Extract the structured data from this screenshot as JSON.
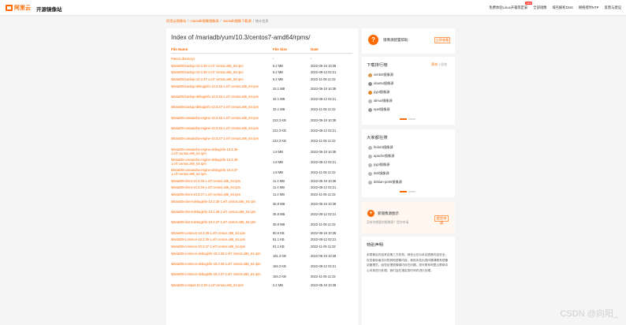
{
  "header": {
    "logo": "阿里云",
    "site_title": "开源镜像站",
    "nav": [
      "免费体验Linux开箱等定安",
      "全部镜像",
      "域名解析DNS",
      "网络授时NTP",
      "反馈与建议"
    ],
    "nav_badge": "NEW"
  },
  "breadcrumb": [
    "阿里云镜像站",
    "mariadb镜像镜像源",
    "mariadb镜像下载源",
    "统计信息"
  ],
  "listing": {
    "title": "Index of /mariadb/yum/10.3/centos7-amd64/rpms/",
    "headers": {
      "name": "File Name",
      "size": "File Size",
      "date": "Date"
    },
    "rows": [
      {
        "name": "Parent directory/",
        "size": "-",
        "date": "-"
      },
      {
        "name": "MariaDB-backup-10.3.35-1.el7.centos.x86_64.rpm",
        "size": "6.2 MB",
        "date": "2022-05-19 10:38"
      },
      {
        "name": "MariaDB-backup-10.3.36-1.el7.centos.x86_64.rpm",
        "size": "6.2 MB",
        "date": "2022-08-12 02:21"
      },
      {
        "name": "MariaDB-backup-10.3.37-1.el7.centos.x86_64.rpm",
        "size": "6.2 MB",
        "date": "2022-11-05 11:32"
      },
      {
        "name": "MariaDB-backup-debuginfo-10.3.35-1.el7.centos.x86_64.rpm",
        "size": "33.1 MB",
        "date": "2022-05-19 10:38"
      },
      {
        "name": "MariaDB-backup-debuginfo-10.3.36-1.el7.centos.x86_64.rpm",
        "size": "33.1 MB",
        "date": "2022-08-12 02:21"
      },
      {
        "name": "MariaDB-backup-debuginfo-10.3.37-1.el7.centos.x86_64.rpm",
        "size": "33.1 MB",
        "date": "2022-11-05 11:32"
      },
      {
        "name": "MariaDB-cassandra-engine-10.3.35-1.el7.centos.x86_64.rpm",
        "size": "222.3 KB",
        "date": "2022-05-19 10:38"
      },
      {
        "name": "MariaDB-cassandra-engine-10.3.36-1.el7.centos.x86_64.rpm",
        "size": "222.3 KB",
        "date": "2022-08-12 02:21"
      },
      {
        "name": "MariaDB-cassandra-engine-10.3.37-1.el7.centos.x86_64.rpm",
        "size": "222.3 KB",
        "date": "2022-11-05 11:32"
      },
      {
        "name": "MariaDB-cassandra-engine-debuginfo-10.3.35-1.el7.centos.x86_64.rpm",
        "size": "1.8 MB",
        "date": "2022-05-19 10:38"
      },
      {
        "name": "MariaDB-cassandra-engine-debuginfo-10.3.36-1.el7.centos.x86_64.rpm",
        "size": "1.8 MB",
        "date": "2022-08-12 02:21"
      },
      {
        "name": "MariaDB-cassandra-engine-debuginfo-10.3.37-1.el7.centos.x86_64.rpm",
        "size": "1.8 MB",
        "date": "2022-11-05 11:32"
      },
      {
        "name": "MariaDB-client-10.3.35-1.el7.centos.x86_64.rpm",
        "size": "11.4 MB",
        "date": "2022-05-19 10:38"
      },
      {
        "name": "MariaDB-client-10.3.36-1.el7.centos.x86_64.rpm",
        "size": "11.4 MB",
        "date": "2022-08-12 02:21"
      },
      {
        "name": "MariaDB-client-10.3.37-1.el7.centos.x86_64.rpm",
        "size": "11.4 MB",
        "date": "2022-11-05 11:32"
      },
      {
        "name": "MariaDB-client-debuginfo-10.3.35-1.el7.centos.x86_64.rpm",
        "size": "35.8 MB",
        "date": "2022-05-19 10:38"
      },
      {
        "name": "MariaDB-client-debuginfo-10.3.36-1.el7.centos.x86_64.rpm",
        "size": "35.8 MB",
        "date": "2022-08-12 02:21"
      },
      {
        "name": "MariaDB-client-debuginfo-10.3.37-1.el7.centos.x86_64.rpm",
        "size": "35.8 MB",
        "date": "2022-11-05 11:32"
      },
      {
        "name": "MariaDB-common-10.3.35-1.el7.centos.x86_64.rpm",
        "size": "80.6 KB",
        "date": "2022-05-19 10:38"
      },
      {
        "name": "MariaDB-common-10.3.36-1.el7.centos.x86_64.rpm",
        "size": "81.1 KB",
        "date": "2022-08-12 02:21"
      },
      {
        "name": "MariaDB-common-10.3.37-1.el7.centos.x86_64.rpm",
        "size": "81.1 KB",
        "date": "2022-11-05 11:32"
      },
      {
        "name": "MariaDB-common-debuginfo-10.3.35-1.el7.centos.x86_64.rpm",
        "size": "181.3 KB",
        "date": "2022-05-19 10:38"
      },
      {
        "name": "MariaDB-common-debuginfo-10.3.36-1.el7.centos.x86_64.rpm",
        "size": "184.2 KB",
        "date": "2022-08-12 02:21"
      },
      {
        "name": "MariaDB-common-debuginfo-10.3.37-1.el7.centos.x86_64.rpm",
        "size": "184.2 KB",
        "date": "2022-11-05 11:32"
      },
      {
        "name": "MariaDB-compat-10.3.35-1.el7.centos.x86_64.rpm",
        "size": "2.2 MB",
        "date": "2022-05-19 10:38"
      }
    ]
  },
  "sidebar": {
    "help": {
      "text": "镜像源配置帮助",
      "button": "立即查看"
    },
    "ranking": {
      "title": "下载排行榜",
      "tab_active": "周先",
      "tab_other": "总先",
      "items": [
        "centos镜像源",
        "ubuntu镜像源",
        "pypi镜像源",
        "alinux镜像源",
        "epel镜像源"
      ]
    },
    "popular": {
      "title": "大家都在搜",
      "items": [
        "fedora镜像源",
        "apache镜像源",
        "pypi镜像源",
        "deb镜像源",
        "debian-ports镜像源"
      ]
    },
    "newmirror": {
      "title": "新镜像源图示",
      "desc": "没有你想要的镜像源？提交申请",
      "button": "提交申请"
    },
    "notice": {
      "title": "特别声明",
      "body": "本镜像站内容来自第三方机构，网信云仅为本站镜像内容安全，仅供使用者访问的其他镜像内容。使用中若出现问题请联系镜像站管理员。如您反馈镜像源内存在问题，您可联系阿里云帮助中心对其进行处理，我们会在规定的时间内进行处理。"
    }
  },
  "watermark": "CSDN @向阳_"
}
